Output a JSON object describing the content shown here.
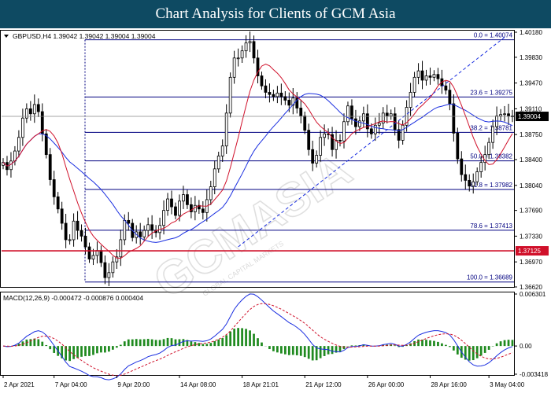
{
  "banner": {
    "title": "Chart Analysis for Clients of GCM Asia"
  },
  "chart_data": {
    "type": "line",
    "symbol_header": "GBPUSD,H4  1.39042 1.39042 1.39004 1.39004",
    "watermark": "GCMASIA",
    "watermark_sub": "GLOBAL CAPITAL MARKETS",
    "price_ylim": [
      1.3662,
      1.4018
    ],
    "price_ticks": [
      "1.40180",
      "1.39830",
      "1.39470",
      "1.39110",
      "1.38750",
      "1.38400",
      "1.38040",
      "1.37690",
      "1.37330",
      "1.36970",
      "1.36620"
    ],
    "price_tick_values": [
      1.4018,
      1.3983,
      1.3947,
      1.3911,
      1.3875,
      1.384,
      1.3804,
      1.3769,
      1.3733,
      1.3697,
      1.3662
    ],
    "current_price": {
      "value": 1.39004,
      "label": "1.39004",
      "color": "#000000"
    },
    "support_level": {
      "value": 1.37125,
      "label": "1.37125",
      "color": "#d0102a"
    },
    "fib_levels": [
      {
        "label": "0.0 = 1.40074",
        "value": 1.40074
      },
      {
        "label": "23.6 = 1.39275",
        "value": 1.39275
      },
      {
        "label": "38.2 = 1.38781",
        "value": 1.38781
      },
      {
        "label": "50.0 = 1.38382",
        "value": 1.38382
      },
      {
        "label": "61.8 = 1.37982",
        "value": 1.37982
      },
      {
        "label": "78.6 = 1.37413",
        "value": 1.37413
      },
      {
        "label": "100.0 = 1.36689",
        "value": 1.36689
      }
    ],
    "x_labels": [
      "2 Apr 2021",
      "7 Apr 04:00",
      "9 Apr 20:00",
      "14 Apr 08:00",
      "18 Apr 21:01",
      "21 Apr 12:00",
      "26 Apr 00:00",
      "28 Apr 16:00",
      "3 May 04:00"
    ],
    "x_label_index": [
      0,
      13,
      29,
      45,
      61,
      77,
      93,
      109,
      124
    ],
    "n_bars": 131,
    "close_series": [
      1.3836,
      1.3826,
      1.3838,
      1.3852,
      1.3871,
      1.3898,
      1.3911,
      1.3904,
      1.3917,
      1.3907,
      1.3876,
      1.3847,
      1.3812,
      1.3788,
      1.3771,
      1.3751,
      1.3728,
      1.3728,
      1.3754,
      1.3741,
      1.3733,
      1.3718,
      1.3701,
      1.3706,
      1.3713,
      1.3696,
      1.3675,
      1.3682,
      1.3697,
      1.3704,
      1.3728,
      1.3755,
      1.3751,
      1.3731,
      1.3739,
      1.3732,
      1.3741,
      1.3749,
      1.3741,
      1.3738,
      1.3748,
      1.3769,
      1.3785,
      1.3774,
      1.3762,
      1.3782,
      1.3791,
      1.3777,
      1.3767,
      1.3776,
      1.3771,
      1.3766,
      1.3784,
      1.3802,
      1.3827,
      1.3845,
      1.3859,
      1.3905,
      1.3955,
      1.3982,
      1.3982,
      1.3992,
      1.4003,
      1.4005,
      1.3982,
      1.3957,
      1.3943,
      1.3934,
      1.3931,
      1.3928,
      1.3933,
      1.3928,
      1.3923,
      1.3916,
      1.3926,
      1.3912,
      1.3901,
      1.3881,
      1.3854,
      1.3835,
      1.3846,
      1.3871,
      1.3876,
      1.3875,
      1.3854,
      1.3867,
      1.3866,
      1.3893,
      1.3915,
      1.3897,
      1.3886,
      1.3894,
      1.3904,
      1.3883,
      1.3876,
      1.3888,
      1.3891,
      1.3905,
      1.3901,
      1.3904,
      1.3882,
      1.3867,
      1.3888,
      1.3913,
      1.3934,
      1.3955,
      1.3964,
      1.3951,
      1.3957,
      1.3955,
      1.3959,
      1.3953,
      1.3943,
      1.3937,
      1.3918,
      1.3877,
      1.3841,
      1.3819,
      1.3811,
      1.3803,
      1.3809,
      1.3823,
      1.3836,
      1.3847,
      1.3864,
      1.3886,
      1.3901,
      1.3903,
      1.3904,
      1.3901,
      1.39
    ],
    "ma_fast_color": "#d0102a",
    "ma_slow_color": "#1a2ee0",
    "trendline": {
      "from_index": 60,
      "from_price": 1.3718,
      "to_index": 128,
      "to_price": 1.4011
    },
    "macd": {
      "label": "MACD(12,26,9) -0.000472 -0.000876 0.000404",
      "ylim": [
        -0.003418,
        0.006301
      ],
      "ticks": [
        "0.006301",
        "0.00",
        "-0.003418"
      ],
      "tick_values": [
        0.006301,
        0,
        -0.003418
      ],
      "macd_color": "#1a2ee0",
      "signal_color": "#d0102a",
      "hist_color": "#1f8a1f"
    }
  }
}
